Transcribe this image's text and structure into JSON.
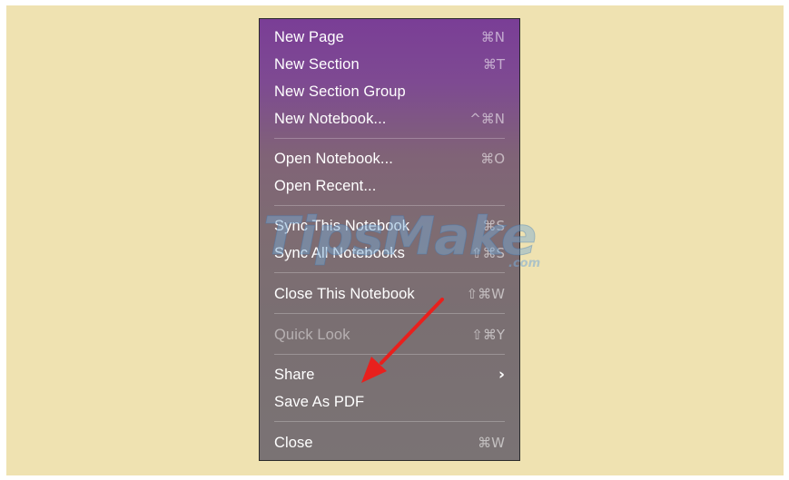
{
  "menu": {
    "items": [
      {
        "label": "New Page",
        "shortcut": "⌘N"
      },
      {
        "label": "New Section",
        "shortcut": "⌘T"
      },
      {
        "label": "New Section Group",
        "shortcut": ""
      },
      {
        "label": "New Notebook...",
        "shortcut": "^⌘N"
      },
      {
        "label": "Open Notebook...",
        "shortcut": "⌘O"
      },
      {
        "label": "Open Recent...",
        "shortcut": ""
      },
      {
        "label": "Sync This Notebook",
        "shortcut": "⌘S"
      },
      {
        "label": "Sync All Notebooks",
        "shortcut": "⇧⌘S"
      },
      {
        "label": "Close This Notebook",
        "shortcut": "⇧⌘W"
      },
      {
        "label": "Quick Look",
        "shortcut": "⇧⌘Y",
        "disabled": true
      },
      {
        "label": "Share",
        "submenu_indicator": "›"
      },
      {
        "label": "Save As PDF",
        "shortcut": ""
      },
      {
        "label": "Close",
        "shortcut": "⌘W"
      }
    ]
  },
  "watermark": {
    "text": "TipsMake",
    "suffix": ".com"
  },
  "annotation": {
    "icon": "red-arrow-icon",
    "color": "#e8201d"
  },
  "colors": {
    "background": "#efe2b1",
    "menu_top": "#7a3e96",
    "menu_bottom": "#7a7374"
  }
}
